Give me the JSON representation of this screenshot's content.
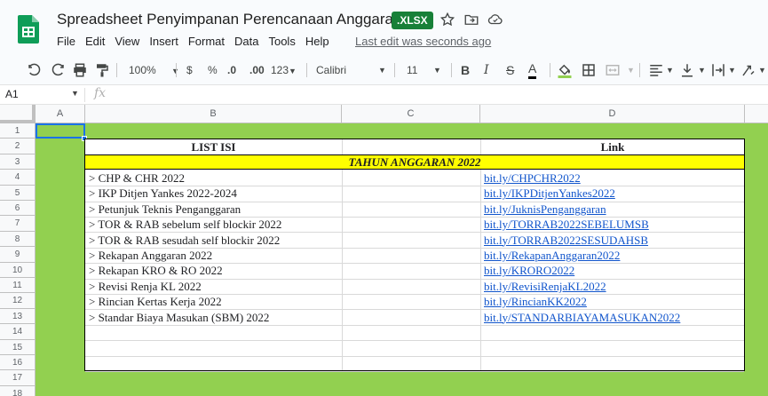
{
  "app": {
    "doc_title": "Spreadsheet Penyimpanan Perencanaan Anggaran",
    "file_badge": ".XLSX",
    "last_edit": "Last edit was seconds ago",
    "menu": [
      "File",
      "Edit",
      "View",
      "Insert",
      "Format",
      "Data",
      "Tools",
      "Help"
    ],
    "brand_color": "#0f9d58"
  },
  "toolbar": {
    "zoom": "100%",
    "currency": "$",
    "percent": "%",
    "dec_decrease": ".0",
    "dec_increase": ".00",
    "more_formats": "123",
    "font": "Calibri",
    "font_size": "11",
    "bold": "B",
    "italic": "I",
    "strike": "S",
    "text_color_letter": "A",
    "text_color": "#000000",
    "fill_color": "#92d050"
  },
  "formula_bar": {
    "name_box": "A1",
    "fx": "fx"
  },
  "sheet": {
    "background": "#92d050",
    "columns": [
      "A",
      "B",
      "C",
      "D"
    ],
    "rows": [
      "1",
      "2",
      "3",
      "4",
      "5",
      "6",
      "7",
      "8",
      "9",
      "10",
      "11",
      "12",
      "13",
      "14",
      "15",
      "16",
      "17",
      "18"
    ],
    "header_b": "LIST ISI",
    "header_d": "Link",
    "year_banner": "TAHUN ANGGARAN 2022",
    "items": [
      {
        "name": "> CHP & CHR 2022",
        "link": "bit.ly/CHPCHR2022"
      },
      {
        "name": "> IKP Ditjen Yankes 2022-2024",
        "link": "bit.ly/IKPDitjenYankes2022"
      },
      {
        "name": "> Petunjuk Teknis Penganggaran",
        "link": "bit.ly/JuknisPenganggaran"
      },
      {
        "name": "> TOR & RAB sebelum self blockir 2022",
        "link": "bit.ly/TORRAB2022SEBELUMSB"
      },
      {
        "name": "> TOR & RAB sesudah self blockir 2022",
        "link": "bit.ly/TORRAB2022SESUDAHSB"
      },
      {
        "name": "> Rekapan Anggaran 2022",
        "link": "bit.ly/RekapanAnggaran2022"
      },
      {
        "name": "> Rekapan KRO & RO 2022",
        "link": "bit.ly/KRORO2022"
      },
      {
        "name": "> Revisi Renja KL 2022",
        "link": "bit.ly/RevisiRenjaKL2022"
      },
      {
        "name": "> Rincian Kertas Kerja 2022",
        "link": "bit.ly/RincianKK2022"
      },
      {
        "name": "> Standar Biaya Masukan (SBM) 2022",
        "link": "bit.ly/STANDARBIAYAMASUKAN2022"
      }
    ]
  }
}
